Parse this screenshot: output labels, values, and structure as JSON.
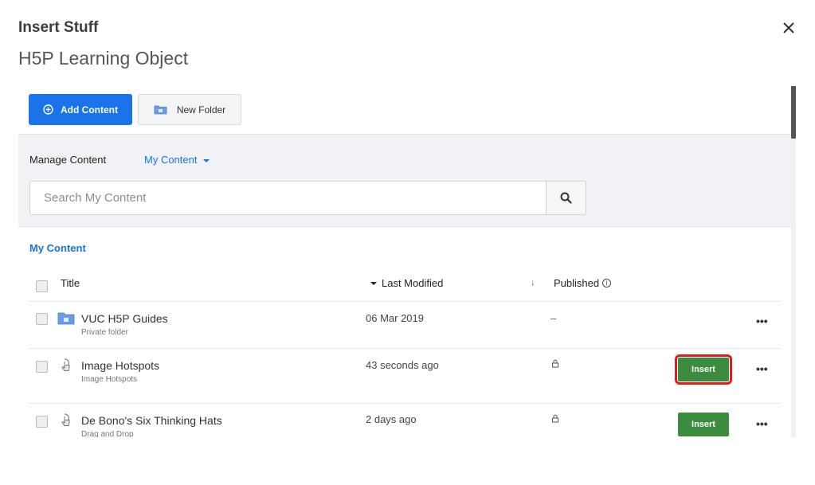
{
  "dialog": {
    "title": "Insert Stuff",
    "subtitle": "H5P Learning Object"
  },
  "toolbar": {
    "add_label": "Add Content",
    "folder_label": "New Folder"
  },
  "manage": {
    "label": "Manage Content",
    "scope": "My Content",
    "search_placeholder": "Search My Content"
  },
  "section_title": "My Content",
  "columns": {
    "title": "Title",
    "modified": "Last Modified",
    "published": "Published"
  },
  "rows": [
    {
      "title": "VUC H5P Guides",
      "subtitle": "Private folder",
      "modified": "06 Mar 2019",
      "published": "–",
      "icon": "folder-icon"
    },
    {
      "title": "Image Hotspots",
      "subtitle": "Image Hotspots",
      "modified": "43 seconds ago",
      "published": "lock-icon",
      "icon": "content-icon",
      "insert": "Insert",
      "highlighted": true
    },
    {
      "title": "De Bono's Six Thinking Hats",
      "subtitle": "Drag and Drop",
      "modified": "2 days ago",
      "published": "lock-icon",
      "icon": "content-icon",
      "insert": "Insert"
    }
  ],
  "more_label": "•••",
  "colors": {
    "primary": "#1a73e8",
    "insert_green": "#3c8c3f",
    "highlight_red": "#e21c1c",
    "panel_bg": "#f0f2f5"
  }
}
